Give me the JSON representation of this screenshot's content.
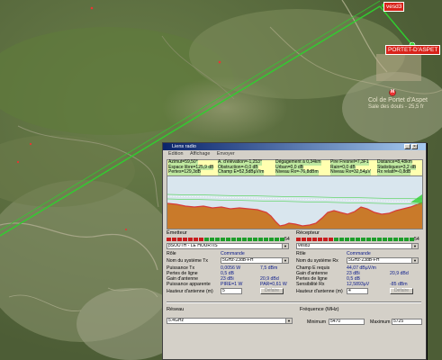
{
  "map": {
    "site_receiver": "vesd3",
    "site_transmitter_town": "PORTET-D'ASPET",
    "poi": "Col de Portet d'Aspet",
    "poi_sub": "Sale des douls - 25,5 fr",
    "poi_marker": "M",
    "colors": {
      "link_line": "#2fcf2f",
      "tag_bg": "#d8231a"
    }
  },
  "window": {
    "title": "Liens radio",
    "menu": [
      "Edition",
      "Affichage",
      "Envoyer"
    ],
    "stats": [
      [
        "Azimut=59,50°",
        "A. d'élévation=-1,253°",
        "Dégagement à 0,34km",
        "Pire Fresnel=7,3F1",
        "Distance=8,48km"
      ],
      [
        "Espace libre=125,9 dB",
        "Obstruction=-0,0 dB",
        "Urban=0,0 dB",
        "Rain=0,0 dB",
        "Statistiques=3,2 dB"
      ],
      [
        "Pertes=129,3dB",
        "Champ E=52,5dBµV/m",
        "Niveau Rx=-76,8dBm",
        "Niveau Rx=32,54µV",
        "Rx relatif=-0,8dB"
      ]
    ],
    "emitter": {
      "heading": "Émetteur",
      "meter_value": "54",
      "site": "pSOUTH - LE HOURTIS",
      "role_label": "Rôle",
      "role_value": "Commande",
      "system_label": "Nom du système Tx",
      "system_value": "5GHz-23dB-FH",
      "power_label": "Puissance Tx",
      "power_w": "0,0056 W",
      "power_dbm": "7,5 dBm",
      "line_loss_label": "Pertes de ligne",
      "line_loss": "0,5 dB",
      "gain_label": "Gain d'antenne",
      "gain_dbi": "23 dBi",
      "gain_dbd": "20,9 dBd",
      "eirp_label": "Puissance apparente",
      "pire": "PIRE=1 W",
      "par": "PAR=0,61 W",
      "height_label": "Hauteur d'antenne (m)",
      "height_value": "5",
      "button": "Défaire"
    },
    "receiver": {
      "heading": "Récepteur",
      "meter_value": "54",
      "site": "vesd3",
      "role_label": "Rôle",
      "role_value": "Commande",
      "system_label": "Nom du système Rx",
      "system_value": "5GHz-23dB-FH",
      "field_label": "Champ E requis",
      "field_value": "44,07 dBµV/m",
      "gain_label": "Gain d'antenne",
      "gain_dbi": "23 dBi",
      "gain_dbd": "20,9 dBd",
      "line_loss_label": "Pertes de ligne",
      "line_loss": "0,5 dB",
      "sens_label": "Sensibilité Rx",
      "sens_uv": "12,5893µV",
      "sens_dbm": "-85 dBm",
      "height_label": "Hauteur d'antenne (m)",
      "height_value": "4",
      "button": "Défaire"
    },
    "network": {
      "heading": "Réseau",
      "value": "5.4GHz"
    },
    "frequency": {
      "heading": "Fréquence (MHz)",
      "min_label": "Minimum",
      "min_value": "5470",
      "max_label": "Maximum",
      "max_value": "5725"
    },
    "colors": {
      "terrain": "#c97a2a",
      "sky": "#d9e6ee",
      "fresnel": "#d63a3a",
      "stats_bg": "#bfe8a0",
      "meter_red": "#c81e1e",
      "meter_green": "#1e9e2a"
    }
  }
}
